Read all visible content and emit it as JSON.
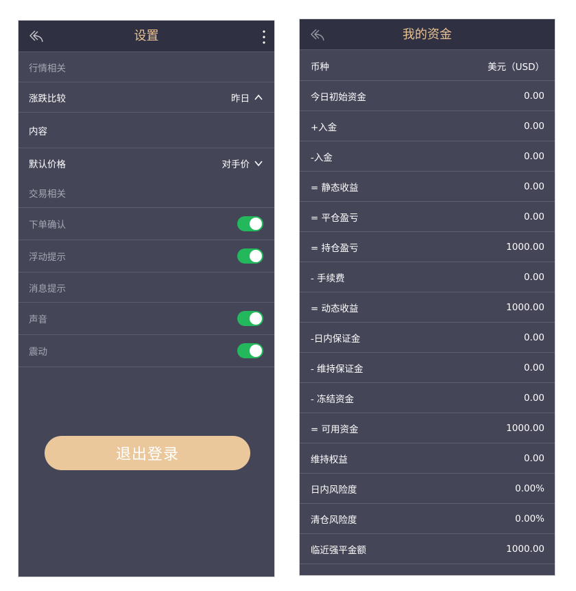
{
  "settings": {
    "title": "设置",
    "section_market": "行情相关",
    "change_compare": {
      "label": "涨跌比较",
      "value": "昨日"
    },
    "content_label": "内容",
    "default_price": {
      "label": "默认价格",
      "value": "对手价"
    },
    "section_trade": "交易相关",
    "order_confirm": {
      "label": "下单确认",
      "on": true
    },
    "float_hint": {
      "label": "浮动提示",
      "on": true
    },
    "section_message": "消息提示",
    "sound": {
      "label": "声音",
      "on": true
    },
    "vibrate": {
      "label": "震动",
      "on": true
    },
    "logout_label": "退出登录"
  },
  "funds": {
    "title": "我的资金",
    "rows": [
      {
        "label": "币种",
        "value": "美元（USD）"
      },
      {
        "label": "今日初始资金",
        "value": "0.00"
      },
      {
        "label": "+入金",
        "value": "0.00"
      },
      {
        "label": "-入金",
        "value": "0.00"
      },
      {
        "label": "= 静态收益",
        "value": "0.00"
      },
      {
        "label": "= 平仓盈亏",
        "value": "0.00"
      },
      {
        "label": "= 持仓盈亏",
        "value": "1000.00"
      },
      {
        "label": "- 手续费",
        "value": "0.00"
      },
      {
        "label": "= 动态收益",
        "value": "1000.00"
      },
      {
        "label": "-日内保证金",
        "value": "0.00"
      },
      {
        "label": "- 维持保证金",
        "value": "0.00"
      },
      {
        "label": "- 冻结资金",
        "value": "0.00"
      },
      {
        "label": "= 可用资金",
        "value": "1000.00"
      },
      {
        "label": "维持权益",
        "value": "0.00"
      },
      {
        "label": "日内风险度",
        "value": "0.00%"
      },
      {
        "label": "清仓风险度",
        "value": "0.00%"
      },
      {
        "label": "临近强平金额",
        "value": "1000.00"
      }
    ]
  },
  "colors": {
    "panel_bg": "#444658",
    "header_bg": "#2f3142",
    "accent_gold": "#e8c192",
    "toggle_on": "#23b85c",
    "logout_bg": "#ebc79c"
  },
  "icons": {
    "back": "back-arrow-icon",
    "more": "more-vertical-icon",
    "chevron_up": "chevron-up-icon",
    "chevron_down": "chevron-down-icon"
  }
}
